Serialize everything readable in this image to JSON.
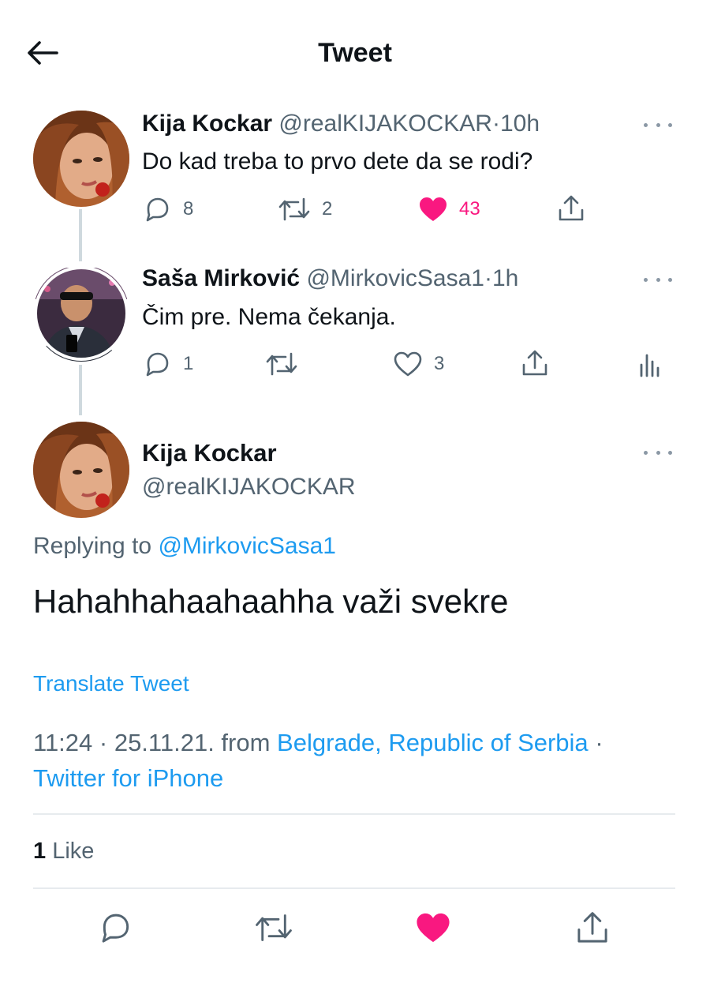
{
  "header": {
    "title": "Tweet",
    "back_icon": "arrow-left-icon"
  },
  "thread": [
    {
      "name": "Kija Kockar",
      "handle": "@realKIJAKOCKAR",
      "dot": "·",
      "time": "10h",
      "text": "Do kad treba to prvo dete da se rodi?",
      "actions": {
        "replies": "8",
        "retweets": "2",
        "likes": "43",
        "liked": true
      }
    },
    {
      "name": "Saša Mirković",
      "handle": "@MirkovicSasa1",
      "dot": "·",
      "time": "1h",
      "text": "Čim pre. Nema čekanja.",
      "actions": {
        "replies": "1",
        "retweets": "",
        "likes": "3",
        "liked": false
      }
    }
  ],
  "main_tweet": {
    "name": "Kija Kockar",
    "handle": "@realKIJAKOCKAR",
    "replying_prefix": "Replying to",
    "replying_handle": "@MirkovicSasa1",
    "text": "Hahahhahaahaahha važi svekre",
    "translate": "Translate Tweet",
    "time": "11:24 · 25.11.21. from",
    "location": "Belgrade, Republic of Serbia",
    "sep": "·",
    "source": "Twitter for iPhone",
    "likes_count": "1",
    "likes_label": "Like",
    "liked": true
  },
  "colors": {
    "accent": "#1d9bf0",
    "like": "#f91880",
    "secondary": "#536471"
  }
}
